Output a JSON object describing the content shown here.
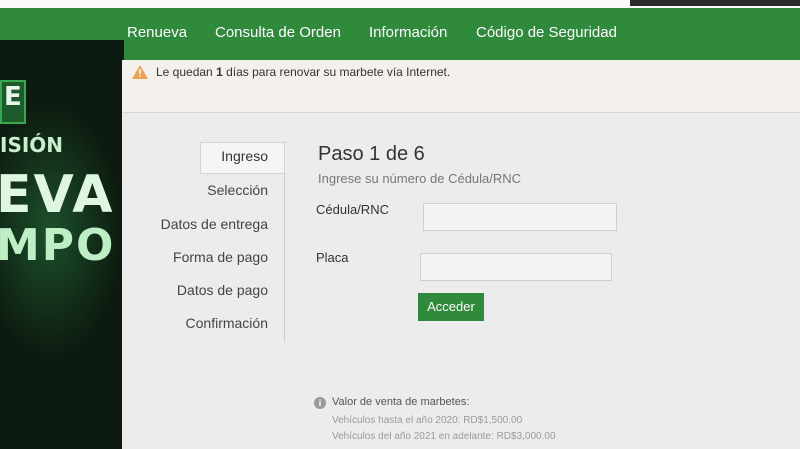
{
  "nav": {
    "items": [
      {
        "label": "Renueva"
      },
      {
        "label": "Consulta de Orden"
      },
      {
        "label": "Información"
      },
      {
        "label": "Código de Seguridad"
      }
    ]
  },
  "background": {
    "bg_label_1": "E",
    "bg_label_2": "ISIÓN",
    "bg_label_3": "EVA",
    "bg_label_4": "MPO"
  },
  "alert": {
    "icon": "warning-icon",
    "text_before": "Le quedan ",
    "days": "1",
    "text_after": " días para renovar su marbete vía Internet."
  },
  "steps": [
    {
      "label": "Ingreso"
    },
    {
      "label": "Selección"
    },
    {
      "label": "Datos de entrega"
    },
    {
      "label": "Forma de pago"
    },
    {
      "label": "Datos de pago"
    },
    {
      "label": "Confirmación"
    }
  ],
  "form": {
    "title": "Paso 1 de 6",
    "subtitle": "Ingrese su número de Cédula/RNC",
    "cedula_label": "Cédula/RNC",
    "cedula_value": "",
    "placa_label": "Placa",
    "placa_value": "",
    "submit_label": "Acceder"
  },
  "info": {
    "icon": "info-icon",
    "title": "Valor de venta de marbetes:",
    "line1": "Vehículos hasta el año 2020: RD$1,500.00",
    "line2": "Vehículos del año 2021 en adelante: RD$3,000.00"
  },
  "colors": {
    "brand_green": "#2f8a3c",
    "panel_bg": "#ececec"
  }
}
